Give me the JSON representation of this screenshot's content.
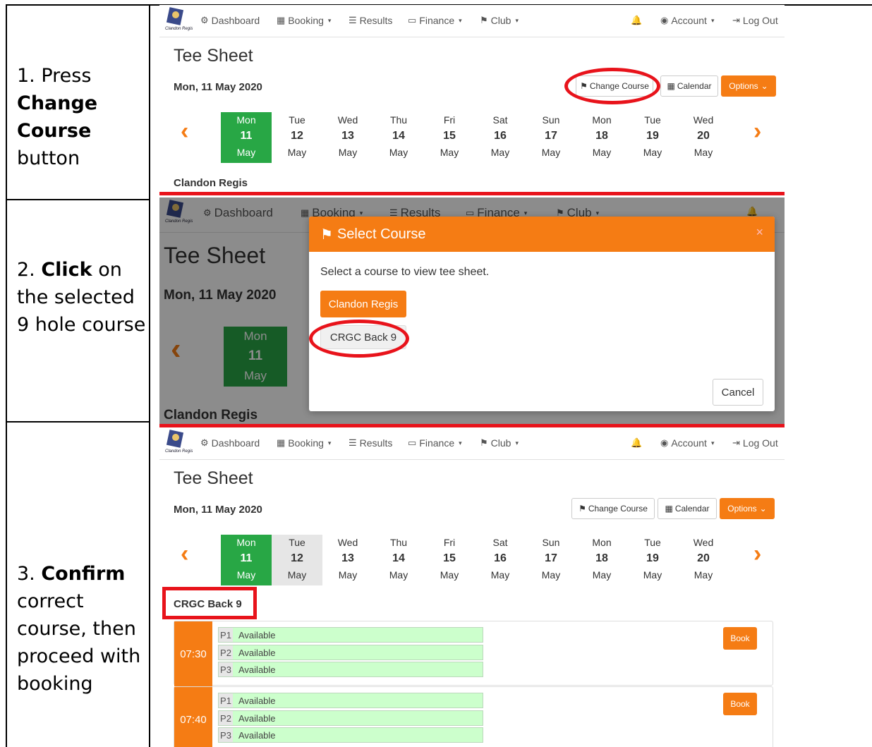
{
  "steps": [
    {
      "pre": "1. Press ",
      "bold": "Change Course",
      "post": " button"
    },
    {
      "pre": "2. ",
      "bold": "Click",
      "post": " on the selected 9 hole course"
    },
    {
      "pre": "3. ",
      "bold": "Confirm",
      "post": " correct course, then proceed with booking"
    }
  ],
  "logo_text": "Clandon Regis",
  "nav": {
    "dashboard": "Dashboard",
    "booking": "Booking",
    "results": "Results",
    "finance": "Finance",
    "club": "Club",
    "account": "Account",
    "logout": "Log Out"
  },
  "page": {
    "title": "Tee Sheet",
    "date": "Mon, 11 May 2020",
    "change_course": "Change Course",
    "calendar": "Calendar",
    "options": "Options"
  },
  "days": [
    {
      "dn": "Mon",
      "num": "11",
      "mon": "May"
    },
    {
      "dn": "Tue",
      "num": "12",
      "mon": "May"
    },
    {
      "dn": "Wed",
      "num": "13",
      "mon": "May"
    },
    {
      "dn": "Thu",
      "num": "14",
      "mon": "May"
    },
    {
      "dn": "Fri",
      "num": "15",
      "mon": "May"
    },
    {
      "dn": "Sat",
      "num": "16",
      "mon": "May"
    },
    {
      "dn": "Sun",
      "num": "17",
      "mon": "May"
    },
    {
      "dn": "Mon",
      "num": "18",
      "mon": "May"
    },
    {
      "dn": "Tue",
      "num": "19",
      "mon": "May"
    },
    {
      "dn": "Wed",
      "num": "20",
      "mon": "May"
    }
  ],
  "course1": "Clandon Regis",
  "modal": {
    "title": "Select Course",
    "text": "Select a course to view tee sheet.",
    "option1": "Clandon Regis",
    "option2": "CRGC Back 9",
    "cancel": "Cancel",
    "close": "×"
  },
  "course3": "CRGC Back 9",
  "slots": [
    {
      "time": "07:30",
      "players": [
        {
          "p": "P1",
          "s": "Available"
        },
        {
          "p": "P2",
          "s": "Available"
        },
        {
          "p": "P3",
          "s": "Available"
        }
      ],
      "book": "Book"
    },
    {
      "time": "07:40",
      "players": [
        {
          "p": "P1",
          "s": "Available"
        },
        {
          "p": "P2",
          "s": "Available"
        },
        {
          "p": "P3",
          "s": "Available"
        }
      ],
      "book": "Book"
    }
  ],
  "colors": {
    "accent": "#f57c14",
    "selected_day": "#28a745",
    "annotation": "#e8131b",
    "available": "#ccffcc"
  }
}
